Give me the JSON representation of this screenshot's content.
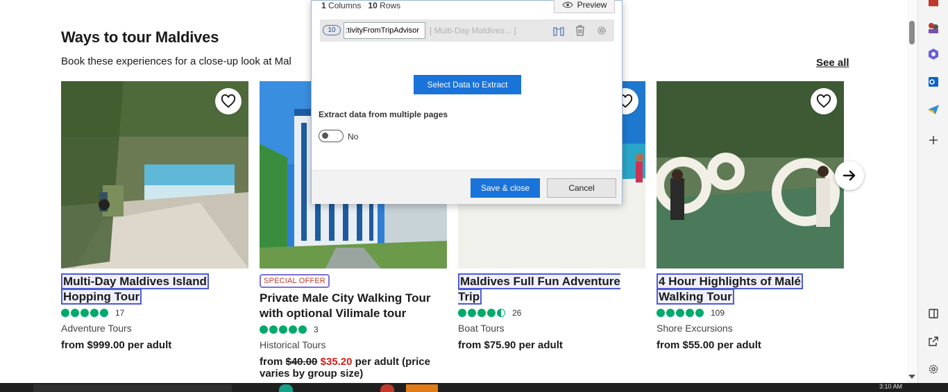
{
  "section": {
    "title": "Ways to tour Maldives",
    "subtitle": "Book these experiences for a close-up look at Mal",
    "see_all": "See all"
  },
  "cards": [
    {
      "title_line1": "Multi-Day Maldives Island",
      "title_line2": "Hopping Tour",
      "rating": 5,
      "review_count": "17",
      "category": "Adventure Tours",
      "price": "from $999.00 per adult"
    },
    {
      "badge": "SPECIAL OFFER",
      "title_line1": "Private Male City Walking Tour",
      "title_line2": "with optional Vilimale tour",
      "rating": 5,
      "review_count": "3",
      "category": "Historical Tours",
      "price_prefix": "from ",
      "price_old": "$40.00",
      "price_new": "$35.20",
      "price_suffix": " per adult (price",
      "price_line2": "varies by group size)"
    },
    {
      "title_line1": "Maldives Full Fun Adventure Trip",
      "rating": 4.5,
      "review_count": "26",
      "category": "Boat Tours",
      "price": "from $75.90 per adult"
    },
    {
      "title_line1": "4 Hour Highlights of Malé",
      "title_line2": "Walking Tour",
      "rating": 5,
      "review_count": "109",
      "category": "Shore Excursions",
      "price": "from $55.00 per adult"
    }
  ],
  "dialog": {
    "columns_count": "1",
    "columns_label": "Columns",
    "rows_count": "10",
    "rows_label": "Rows",
    "preview_label": "Preview",
    "field_index": "10",
    "field_name": ":tivityFromTripAdvisor",
    "field_sample": "[ Multi-Day Maldives... ]",
    "select_button": "Select Data to Extract",
    "multi_page_label": "Extract data from multiple pages",
    "toggle_value": "No",
    "save_button": "Save & close",
    "cancel_button": "Cancel"
  },
  "taskbar": {
    "time": "3:10 AM"
  },
  "colors": {
    "rating_green": "#00aa6c",
    "primary_blue": "#1a73d9",
    "sale_red": "#d0211c",
    "highlight_border": "#4d5bd6"
  }
}
